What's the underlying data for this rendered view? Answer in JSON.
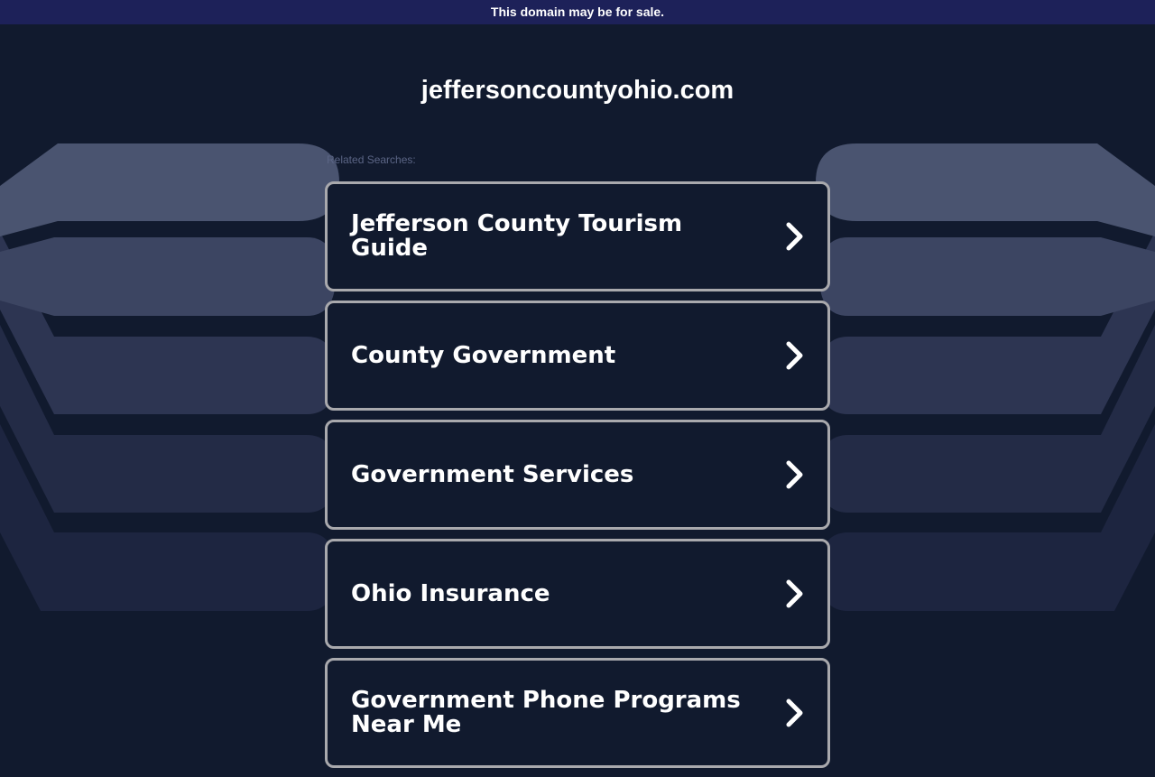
{
  "banner": {
    "text": "This domain may be for sale."
  },
  "header": {
    "domain": "jeffersoncountyohio.com"
  },
  "related": {
    "label": "Related Searches:",
    "items": [
      {
        "label": "Jefferson County Tourism Guide"
      },
      {
        "label": "County Government"
      },
      {
        "label": "Government Services"
      },
      {
        "label": "Ohio Insurance"
      },
      {
        "label": "Government Phone Programs Near Me"
      }
    ]
  },
  "colors": {
    "background": "#111a2e",
    "banner": "#1d2159",
    "card_border": "#a9a9ad",
    "bg_shape_1": "#4a5470",
    "bg_shape_2": "#3c4562",
    "bg_shape_3": "#2d3552",
    "bg_shape_4": "#232b46",
    "bg_shape_5": "#1d2540"
  },
  "icons": {
    "result_arrow": "chevron-right-icon"
  }
}
